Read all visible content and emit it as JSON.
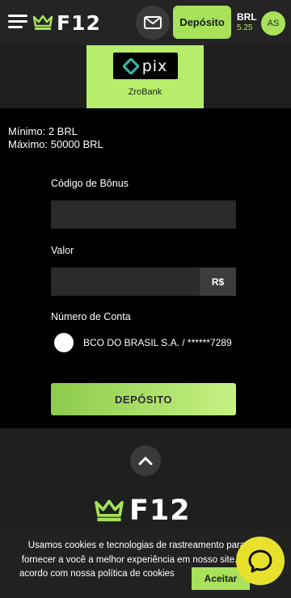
{
  "header": {
    "logo_text": "F12",
    "deposit_label": "Depósito",
    "currency": "BRL",
    "balance": "5.25",
    "avatar_initials": "AS"
  },
  "payment_method": {
    "logo_text": "pix",
    "name": "ZroBank"
  },
  "limits": {
    "min": "Mínimo: 2 BRL",
    "max": "Máximo: 50000 BRL"
  },
  "form": {
    "bonus_label": "Código de Bônus",
    "bonus_value": "",
    "amount_label": "Valor",
    "amount_value": "",
    "amount_suffix": "R$",
    "account_label": "Número de Conta",
    "account_option": "BCO DO BRASIL S.A. / ******7289",
    "submit_label": "DEPÓSITO"
  },
  "footer": {
    "logo_text": "F12"
  },
  "cookie": {
    "line1": "Usamos cookies e tecnologias de rastreamento para",
    "line2": "fornecer a você a melhor experiência em nosso site. De",
    "line3": "acordo com nossa política de cookies",
    "accept_label": "Aceitar"
  },
  "colors": {
    "accent": "#a7e25a",
    "chat": "#e8e12c"
  }
}
